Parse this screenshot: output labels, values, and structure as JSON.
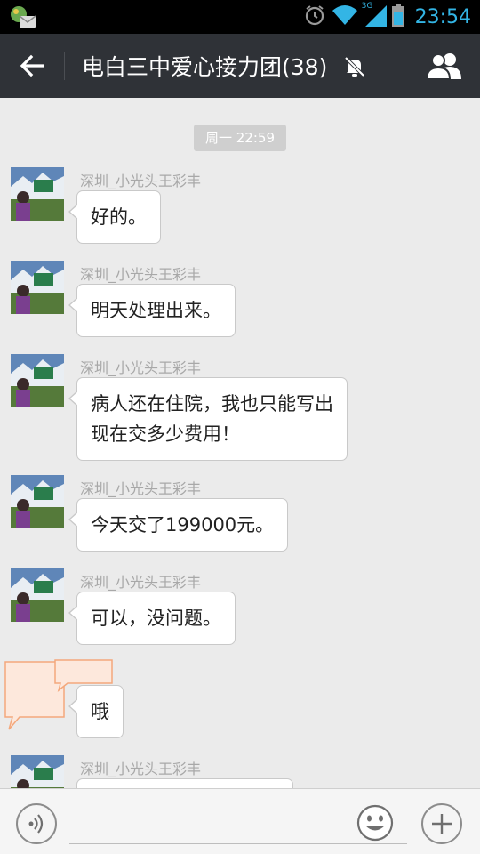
{
  "status_bar": {
    "time": "23:54",
    "network_label": "3G",
    "icons": [
      "app-notification-icon",
      "alarm-icon",
      "wifi-icon",
      "signal-icon",
      "battery-icon"
    ]
  },
  "header": {
    "title": "电白三中爱心接力团(38)",
    "back_icon": "back-arrow-icon",
    "mute_icon": "muted-bell-icon",
    "members_icon": "group-members-icon"
  },
  "chat": {
    "timestamp": "周一 22:59",
    "messages": [
      {
        "sender": "深圳_小光头王彩丰",
        "lines": [
          "好的。"
        ]
      },
      {
        "sender": "深圳_小光头王彩丰",
        "lines": [
          "明天处理出来。"
        ]
      },
      {
        "sender": "深圳_小光头王彩丰",
        "lines": [
          "病人还在住院，我也只能写出",
          "现在交多少费用！"
        ]
      },
      {
        "sender": "深圳_小光头王彩丰",
        "lines": [
          "今天交了199000元。"
        ]
      },
      {
        "sender": "深圳_小光头王彩丰",
        "lines": [
          "可以，没问题。"
        ]
      },
      {
        "sender": "",
        "lines": [
          "哦"
        ]
      },
      {
        "sender": "深圳_小光头王彩丰",
        "lines": [
          ""
        ]
      }
    ]
  },
  "input_bar": {
    "message_value": "",
    "voice_icon": "voice-icon",
    "emoji_icon": "emoji-icon",
    "plus_icon": "plus-icon"
  },
  "colors": {
    "title_bar": "#2f3237",
    "chat_background": "#ebebeb",
    "time_accent": "#33b5e5",
    "placeholder_orange": "#f4a87c"
  }
}
